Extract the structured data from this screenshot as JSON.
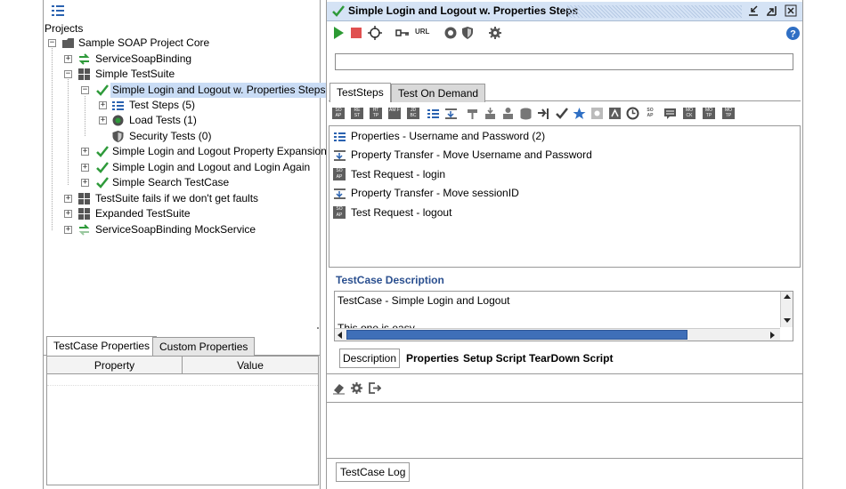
{
  "left_panel": {
    "projects_label": "Projects",
    "tree": [
      {
        "label": "Sample SOAP Project Core",
        "icon": "folder-icon"
      },
      {
        "label": "ServiceSoapBinding",
        "icon": "interface-arrows-icon"
      },
      {
        "label": "Simple TestSuite",
        "icon": "testsuite-grid-icon"
      },
      {
        "label": "Simple Login and Logout w. Properties Steps",
        "icon": "check-icon"
      },
      {
        "label": "Test Steps (5)",
        "icon": "list-icon"
      },
      {
        "label": "Load Tests (1)",
        "icon": "load-test-icon"
      },
      {
        "label": "Security Tests (0)",
        "icon": "shield-icon"
      },
      {
        "label": "Simple Login and Logout Property Expansion",
        "icon": "check-icon"
      },
      {
        "label": "Simple Login and Logout and Login Again",
        "icon": "check-icon"
      },
      {
        "label": "Simple Search TestCase",
        "icon": "check-icon"
      },
      {
        "label": "TestSuite fails if we don't get faults",
        "icon": "testsuite-grid-icon"
      },
      {
        "label": "Expanded TestSuite",
        "icon": "testsuite-grid-icon"
      },
      {
        "label": "ServiceSoapBinding MockService",
        "icon": "mockservice-icon"
      }
    ],
    "props_tabs": [
      "TestCase Properties",
      "Custom Properties"
    ],
    "props_columns": [
      "Property",
      "Value"
    ]
  },
  "right_panel": {
    "title": "Simple Login and Logout w. Properties Steps",
    "toolbar": {
      "run": "run-icon",
      "stop": "stop-icon",
      "endpoint": "target-icon",
      "auth": "key-icon",
      "url_label": "URL",
      "options": "options-icon",
      "security": "shield-icon",
      "settings": "gear-icon",
      "help": "help-icon"
    },
    "main_input_value": "",
    "tabs": [
      "TestSteps",
      "Test On Demand"
    ],
    "steps": [
      {
        "label": "Properties - Username and Password (2)",
        "icon": "properties-icon"
      },
      {
        "label": "Property Transfer - Move Username and Password",
        "icon": "transfer-icon"
      },
      {
        "label": "Test Request - login",
        "icon": "soap-icon"
      },
      {
        "label": "Property Transfer - Move sessionID",
        "icon": "transfer-icon"
      },
      {
        "label": "Test Request - logout",
        "icon": "soap-icon"
      }
    ],
    "desc_header": "TestCase Description",
    "desc_line1": "TestCase - Simple Login and Logout",
    "desc_line2": "This one is easy",
    "bottom_tabs": [
      "Description",
      "Properties",
      "Setup Script",
      "TearDown Script"
    ],
    "log_tab": "TestCase Log",
    "step_toolbar_labels": [
      "SO AP",
      "RE ST",
      "HT TP",
      "AM F",
      "JD BC",
      "SO AP",
      "MO CK",
      "MO TP",
      "MO TP"
    ]
  },
  "colors": {
    "accent_title": "#d5e3f5",
    "desc_header": "#2a4f8f",
    "check_green": "#2e9a3a",
    "run_green": "#2c9a33",
    "stop_red": "#e05050",
    "selection": "#c9dcf5"
  }
}
